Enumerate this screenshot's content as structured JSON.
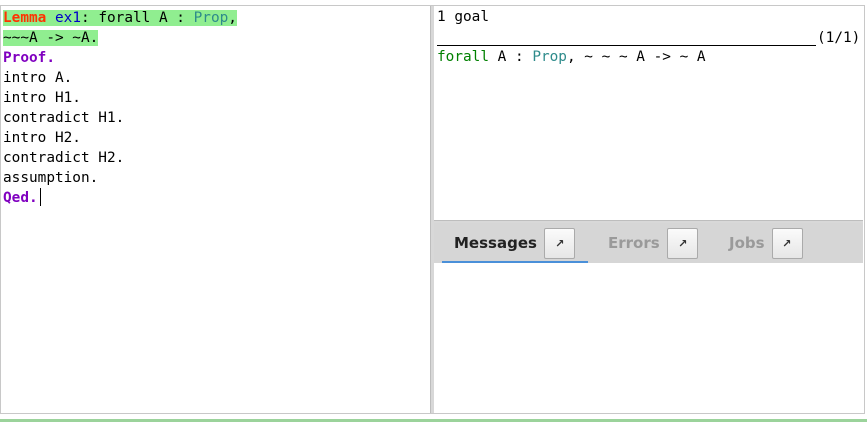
{
  "editor": {
    "lines": [
      {
        "parts": [
          {
            "text": "Lemma",
            "cls": "kw-vernac hl"
          },
          {
            "text": " ",
            "cls": "hl"
          },
          {
            "text": "ex1",
            "cls": "ident-def hl"
          },
          {
            "text": ": forall A : ",
            "cls": "hl"
          },
          {
            "text": "Prop",
            "cls": "ty hl"
          },
          {
            "text": ",",
            "cls": "hl"
          }
        ]
      },
      {
        "parts": [
          {
            "text": "~~~A -> ~A.",
            "cls": "hl"
          }
        ]
      },
      {
        "parts": [
          {
            "text": "Proof.",
            "cls": "kw-proof"
          }
        ]
      },
      {
        "parts": [
          {
            "text": "intro A.",
            "cls": ""
          }
        ]
      },
      {
        "parts": [
          {
            "text": "intro H1.",
            "cls": ""
          }
        ]
      },
      {
        "parts": [
          {
            "text": "contradict H1.",
            "cls": ""
          }
        ]
      },
      {
        "parts": [
          {
            "text": "intro H2.",
            "cls": ""
          }
        ]
      },
      {
        "parts": [
          {
            "text": "contradict H2.",
            "cls": ""
          }
        ]
      },
      {
        "parts": [
          {
            "text": "assumption.",
            "cls": ""
          }
        ]
      },
      {
        "parts": [
          {
            "text": "Qed.",
            "cls": "kw-proof"
          }
        ],
        "cursor": true
      }
    ]
  },
  "goals": {
    "count_text": "1 goal",
    "index_text": "(1/1)",
    "goal_forall": "forall",
    "goal_mid": " A : ",
    "goal_type": "Prop",
    "goal_rest": ", ~ ~ ~ A -> ~ A"
  },
  "tabs": [
    {
      "label": "Messages",
      "active": true,
      "popout": "popout-icon"
    },
    {
      "label": "Errors",
      "active": false,
      "popout": "popout-icon"
    },
    {
      "label": "Jobs",
      "active": false,
      "popout": "popout-icon"
    }
  ],
  "colors": {
    "highlight_processed": "#90ee90",
    "vernacular_keyword": "#ff3300",
    "proof_keyword": "#8000c0",
    "type_color": "#2e8b8b",
    "tab_active_underline": "#4a90d9"
  }
}
